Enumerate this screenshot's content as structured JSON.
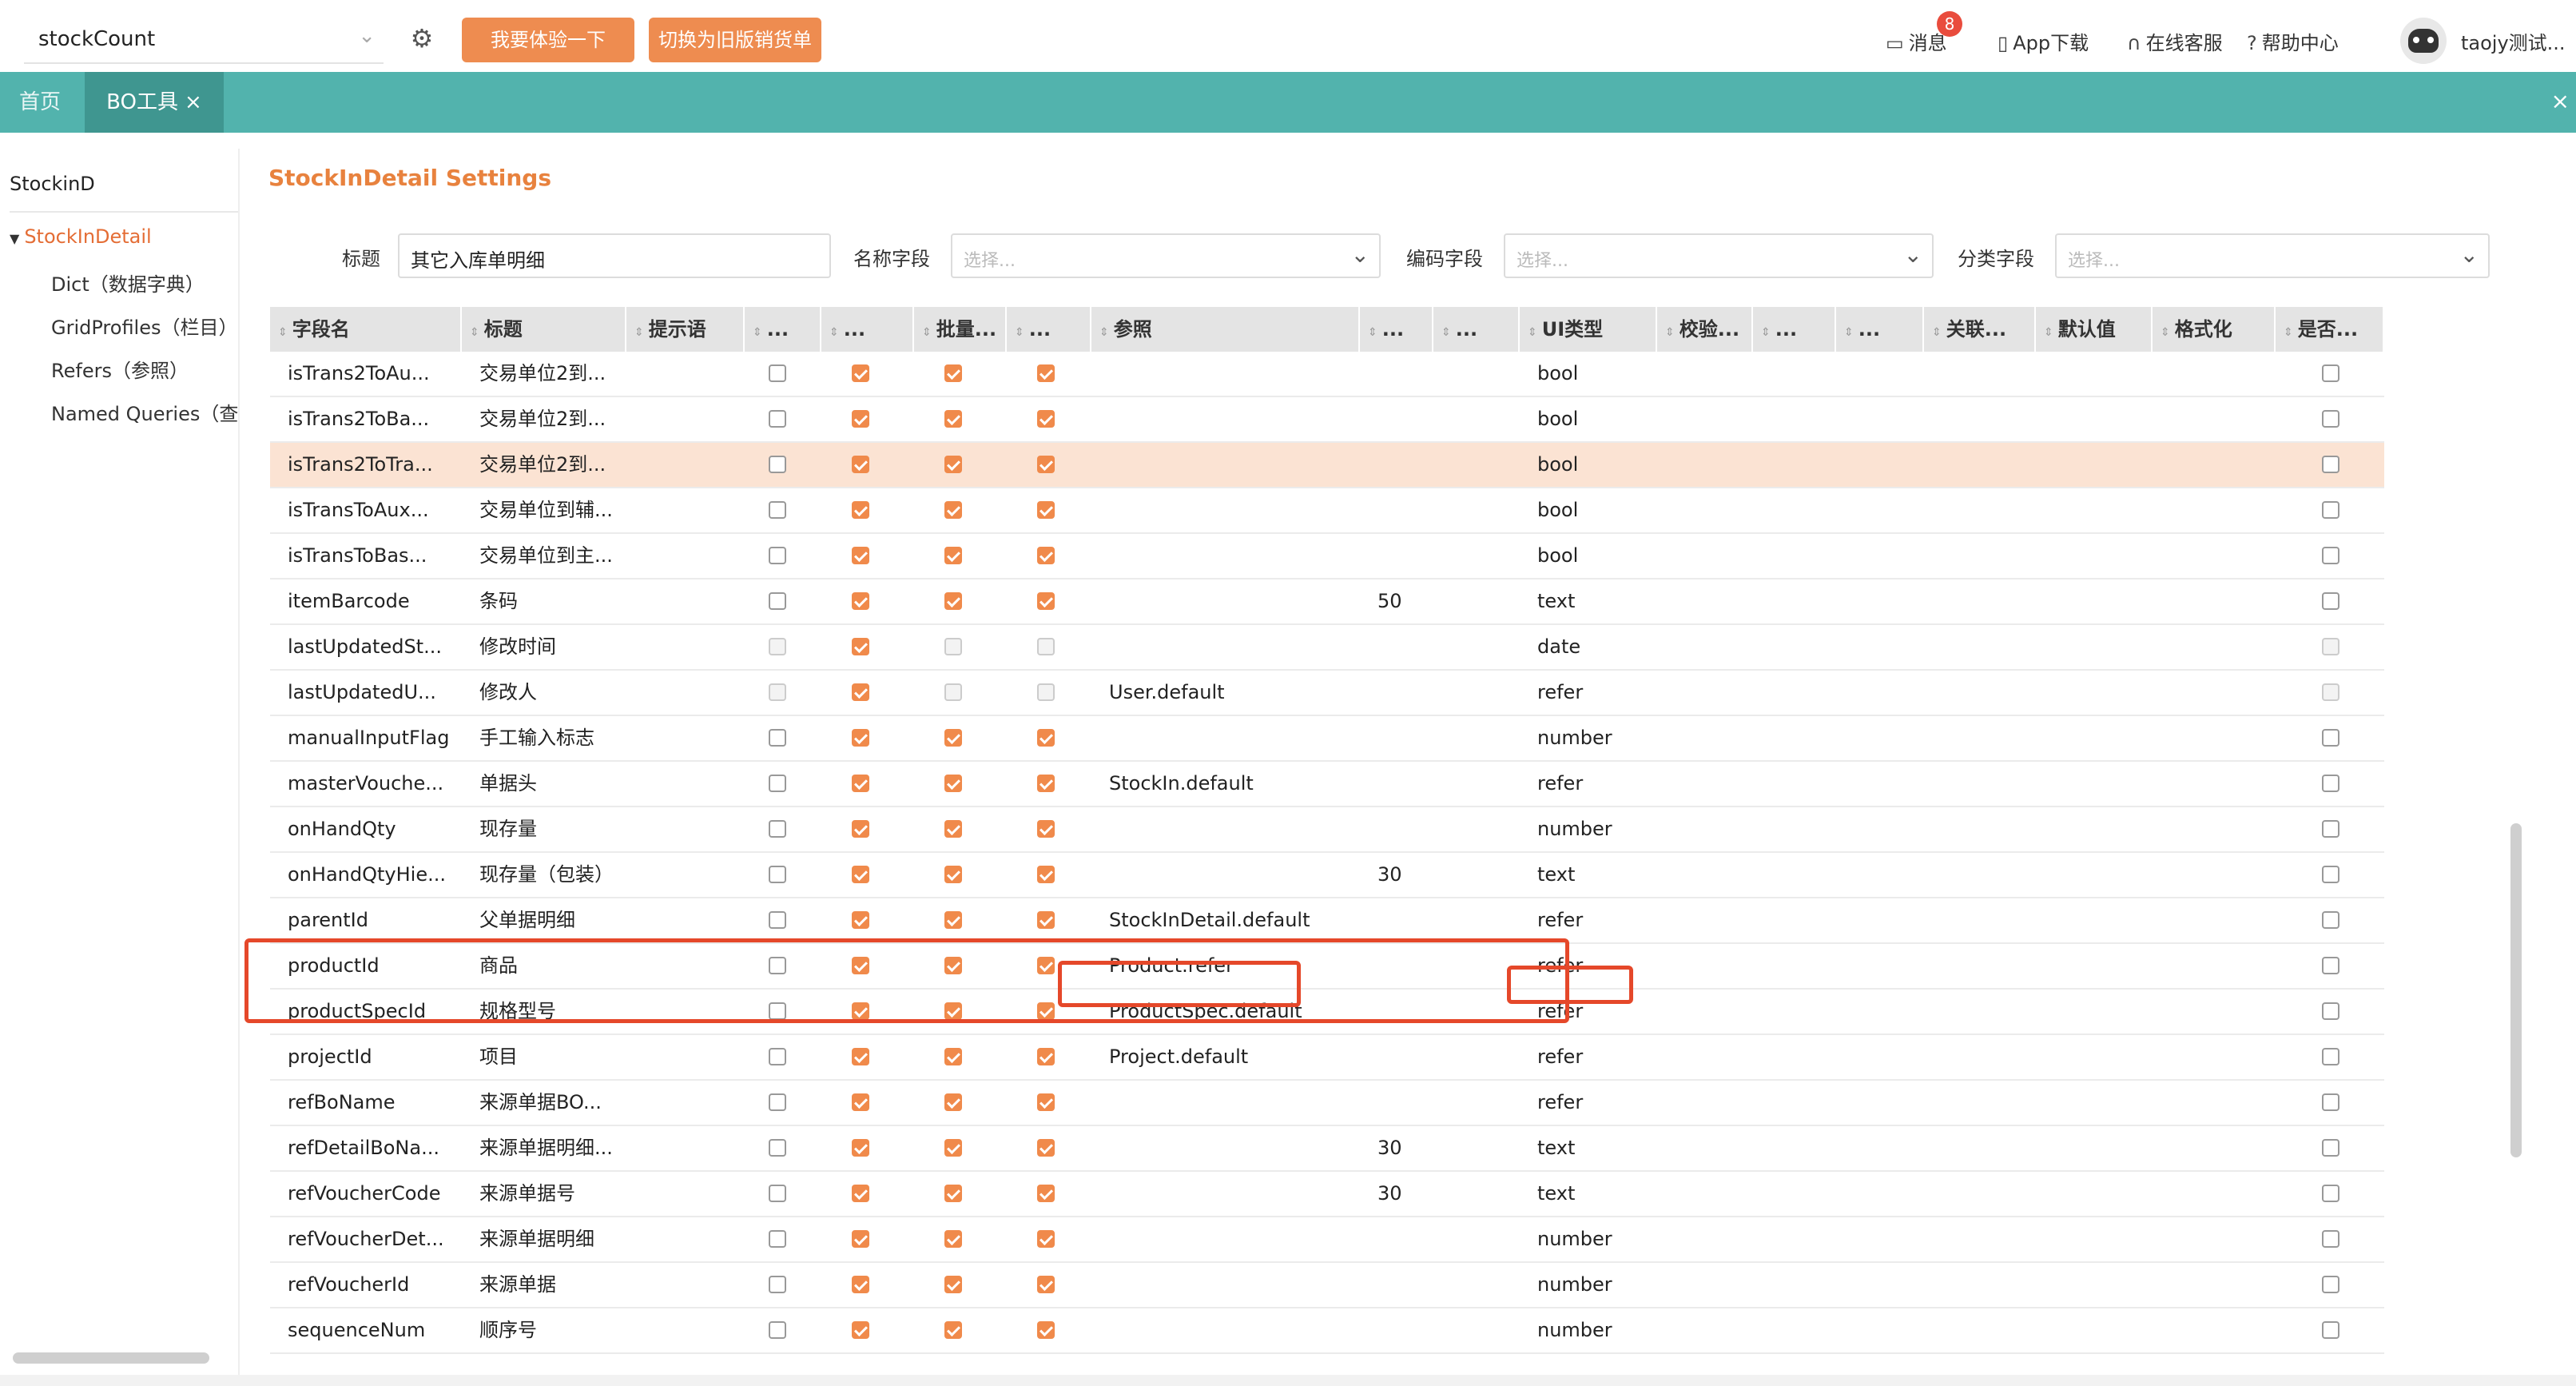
{
  "header": {
    "org_select": "stockCount",
    "try_button": "我要体验一下",
    "switch_button": "切换为旧版销货单",
    "messages_label": "消息",
    "messages_badge": "8",
    "app_download": "App下载",
    "online_service": "在线客服",
    "help_center": "帮助中心",
    "user_name": "taojy测试..."
  },
  "tabs": {
    "home": "首页",
    "bo_tool": "BO工具",
    "close_glyph": "×"
  },
  "tree": {
    "root": "StockinD",
    "active": "StockInDetail",
    "children": [
      "Dict（数据字典）",
      "GridProfiles（栏目）",
      "Refers（参照）",
      "Named Queries（查询"
    ]
  },
  "settings": {
    "title": "StockInDetail Settings",
    "fields": {
      "title_label": "标题",
      "title_value": "其它入库单明细",
      "name_label": "名称字段",
      "code_label": "编码字段",
      "category_label": "分类字段",
      "placeholder": "选择..."
    }
  },
  "grid": {
    "columns": [
      "字段名",
      "标题",
      "提示语",
      "...",
      "...",
      "批量...",
      "...",
      "参照",
      "...",
      "...",
      "UI类型",
      "校验...",
      "...",
      "...",
      "关联...",
      "默认值",
      "格式化",
      "是否..."
    ],
    "rows": [
      {
        "name": "isTrans2ToAu...",
        "title": "交易单位2到...",
        "refer": "",
        "len": "",
        "ui": "bool",
        "c1": "off",
        "c2": "on",
        "c3": "on",
        "c4": "on",
        "last": "off"
      },
      {
        "name": "isTrans2ToBa...",
        "title": "交易单位2到...",
        "refer": "",
        "len": "",
        "ui": "bool",
        "c1": "off",
        "c2": "on",
        "c3": "on",
        "c4": "on",
        "last": "off"
      },
      {
        "name": "isTrans2ToTra...",
        "title": "交易单位2到...",
        "refer": "",
        "len": "",
        "ui": "bool",
        "c1": "off",
        "c2": "on",
        "c3": "on",
        "c4": "on",
        "last": "off",
        "highlight": true
      },
      {
        "name": "isTransToAux...",
        "title": "交易单位到辅...",
        "refer": "",
        "len": "",
        "ui": "bool",
        "c1": "off",
        "c2": "on",
        "c3": "on",
        "c4": "on",
        "last": "off"
      },
      {
        "name": "isTransToBas...",
        "title": "交易单位到主...",
        "refer": "",
        "len": "",
        "ui": "bool",
        "c1": "off",
        "c2": "on",
        "c3": "on",
        "c4": "on",
        "last": "off"
      },
      {
        "name": "itemBarcode",
        "title": "条码",
        "refer": "",
        "len": "50",
        "ui": "text",
        "c1": "off",
        "c2": "on",
        "c3": "on",
        "c4": "on",
        "last": "off"
      },
      {
        "name": "lastUpdatedSt...",
        "title": "修改时间",
        "refer": "",
        "len": "",
        "ui": "date",
        "c1": "dis",
        "c2": "on",
        "c3": "dis",
        "c4": "dis",
        "last": "dis"
      },
      {
        "name": "lastUpdatedU...",
        "title": "修改人",
        "refer": "User.default",
        "len": "",
        "ui": "refer",
        "c1": "dis",
        "c2": "on",
        "c3": "dis",
        "c4": "dis",
        "last": "dis"
      },
      {
        "name": "manualInputFlag",
        "title": "手工输入标志",
        "refer": "",
        "len": "",
        "ui": "number",
        "c1": "off",
        "c2": "on",
        "c3": "on",
        "c4": "on",
        "last": "off"
      },
      {
        "name": "masterVouche...",
        "title": "单据头",
        "refer": "StockIn.default",
        "len": "",
        "ui": "refer",
        "c1": "off",
        "c2": "on",
        "c3": "on",
        "c4": "on",
        "last": "off"
      },
      {
        "name": "onHandQty",
        "title": "现存量",
        "refer": "",
        "len": "",
        "ui": "number",
        "c1": "off",
        "c2": "on",
        "c3": "on",
        "c4": "on",
        "last": "off"
      },
      {
        "name": "onHandQtyHie...",
        "title": "现存量（包装）",
        "refer": "",
        "len": "30",
        "ui": "text",
        "c1": "off",
        "c2": "on",
        "c3": "on",
        "c4": "on",
        "last": "off"
      },
      {
        "name": "parentId",
        "title": "父单据明细",
        "refer": "StockInDetail.default",
        "len": "",
        "ui": "refer",
        "c1": "off",
        "c2": "on",
        "c3": "on",
        "c4": "on",
        "last": "off"
      },
      {
        "name": "productId",
        "title": "商品",
        "refer": "Product.refer",
        "len": "",
        "ui": "refer",
        "c1": "off",
        "c2": "on",
        "c3": "on",
        "c4": "on",
        "last": "off"
      },
      {
        "name": "productSpecId",
        "title": "规格型号",
        "refer": "ProductSpec.default",
        "len": "",
        "ui": "refer",
        "c1": "off",
        "c2": "on",
        "c3": "on",
        "c4": "on",
        "last": "off"
      },
      {
        "name": "projectId",
        "title": "项目",
        "refer": "Project.default",
        "len": "",
        "ui": "refer",
        "c1": "off",
        "c2": "on",
        "c3": "on",
        "c4": "on",
        "last": "off"
      },
      {
        "name": "refBoName",
        "title": "来源单据BO...",
        "refer": "",
        "len": "",
        "ui": "refer",
        "c1": "off",
        "c2": "on",
        "c3": "on",
        "c4": "on",
        "last": "off"
      },
      {
        "name": "refDetailBoNa...",
        "title": "来源单据明细...",
        "refer": "",
        "len": "30",
        "ui": "text",
        "c1": "off",
        "c2": "on",
        "c3": "on",
        "c4": "on",
        "last": "off"
      },
      {
        "name": "refVoucherCode",
        "title": "来源单据号",
        "refer": "",
        "len": "30",
        "ui": "text",
        "c1": "off",
        "c2": "on",
        "c3": "on",
        "c4": "on",
        "last": "off"
      },
      {
        "name": "refVoucherDet...",
        "title": "来源单据明细",
        "refer": "",
        "len": "",
        "ui": "number",
        "c1": "off",
        "c2": "on",
        "c3": "on",
        "c4": "on",
        "last": "off"
      },
      {
        "name": "refVoucherId",
        "title": "来源单据",
        "refer": "",
        "len": "",
        "ui": "number",
        "c1": "off",
        "c2": "on",
        "c3": "on",
        "c4": "on",
        "last": "off"
      },
      {
        "name": "sequenceNum",
        "title": "顺序号",
        "refer": "",
        "len": "",
        "ui": "number",
        "c1": "off",
        "c2": "on",
        "c3": "on",
        "c4": "on",
        "last": "off"
      }
    ]
  },
  "icons": {
    "gear": "gear-icon",
    "chevron": "chevron-down-icon",
    "message": "chat-bubble-icon",
    "phone": "phone-icon",
    "headset": "headset-icon",
    "help": "question-circle-icon",
    "sort": "sort-icon",
    "checkbox": "checkbox-icon"
  },
  "colors": {
    "accent": "#ee8c50",
    "teal": "#52b3ad",
    "annotation_red": "#e5482a",
    "row_highlight": "#fbe3d3"
  }
}
